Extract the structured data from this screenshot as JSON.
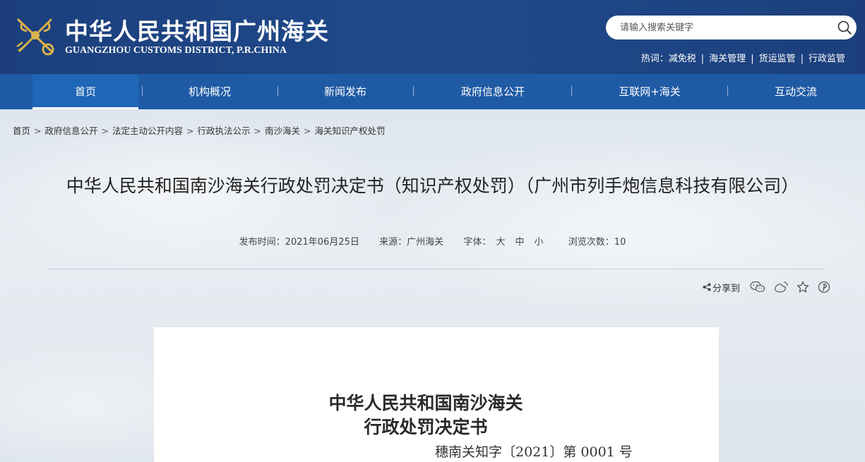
{
  "header": {
    "title": "中华人民共和国广州海关",
    "subtitle": "GUANGZHOU CUSTOMS DISTRICT, P.R.CHINA",
    "logo_icon": "customs-emblem-icon",
    "search": {
      "placeholder": "请输入搜索关键字",
      "icon": "search-icon"
    },
    "hotwords": {
      "label": "热词：",
      "items": [
        "减免税",
        "海关管理",
        "货运监管",
        "行政监管"
      ]
    }
  },
  "nav": {
    "items": [
      {
        "label": "首页",
        "active": true
      },
      {
        "label": "机构概况"
      },
      {
        "label": "新闻发布"
      },
      {
        "label": "政府信息公开"
      },
      {
        "label": "互联网+海关"
      },
      {
        "label": "互动交流"
      }
    ],
    "separator": "|"
  },
  "breadcrumb": {
    "items": [
      "首页",
      "政府信息公开",
      "法定主动公开内容",
      "行政执法公示",
      "南沙海关",
      "海关知识产权处罚"
    ],
    "separator": ">"
  },
  "article": {
    "title": "中华人民共和国南沙海关行政处罚决定书（知识产权处罚）（广州市列手炮信息科技有限公司）",
    "meta": {
      "publish_label": "发布时间：",
      "publish_date": "2021年06月25日",
      "source_label": "来源：",
      "source": "广州海关",
      "font_label": "字体：",
      "font_sizes": [
        "大",
        "中",
        "小"
      ],
      "views_label": "浏览次数：",
      "views": "10"
    },
    "share": {
      "label": "分享到",
      "icons": [
        "wechat-icon",
        "weibo-icon",
        "favorite-star-icon",
        "pinterest-icon"
      ]
    }
  },
  "document": {
    "title_line1": "中华人民共和国南沙海关",
    "title_line2": "行政处罚决定书",
    "number": "穗南关知字〔2021〕第 0001 号"
  },
  "colors": {
    "header_bg": "#1c3f7c",
    "nav_bg": "#1f5aa5",
    "nav_active": "#1e66b6"
  }
}
